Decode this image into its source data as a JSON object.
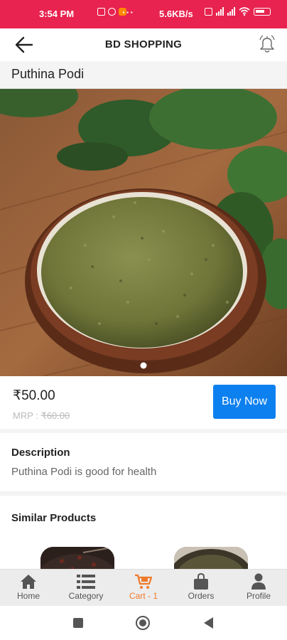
{
  "status_bar": {
    "time": "3:54 PM",
    "network_speed": "5.6KB/s",
    "dots": "···"
  },
  "app_bar": {
    "title": "BD SHOPPING",
    "back_icon": "arrow-left-icon",
    "bell_icon": "bell-icon"
  },
  "product": {
    "name": "Puthina Podi",
    "price": "₹50.00",
    "mrp_label": "MRP : ",
    "mrp_value": "₹60.00",
    "buy_label": "Buy Now",
    "description_heading": "Description",
    "description_text": "Puthina Podi is good for health",
    "image_count": 1,
    "active_image": 1
  },
  "similar": {
    "heading": "Similar Products"
  },
  "bottom_nav": {
    "items": [
      {
        "label": "Home",
        "icon": "home-icon"
      },
      {
        "label": "Category",
        "icon": "list-icon"
      },
      {
        "label": "Cart - 1",
        "icon": "cart-icon"
      },
      {
        "label": "Orders",
        "icon": "bag-icon"
      },
      {
        "label": "Profile",
        "icon": "person-icon"
      }
    ],
    "active_index": 2
  },
  "colors": {
    "status_bar": "#e8234f",
    "primary_button": "#0d80f0",
    "active_nav": "#f07a2a"
  }
}
